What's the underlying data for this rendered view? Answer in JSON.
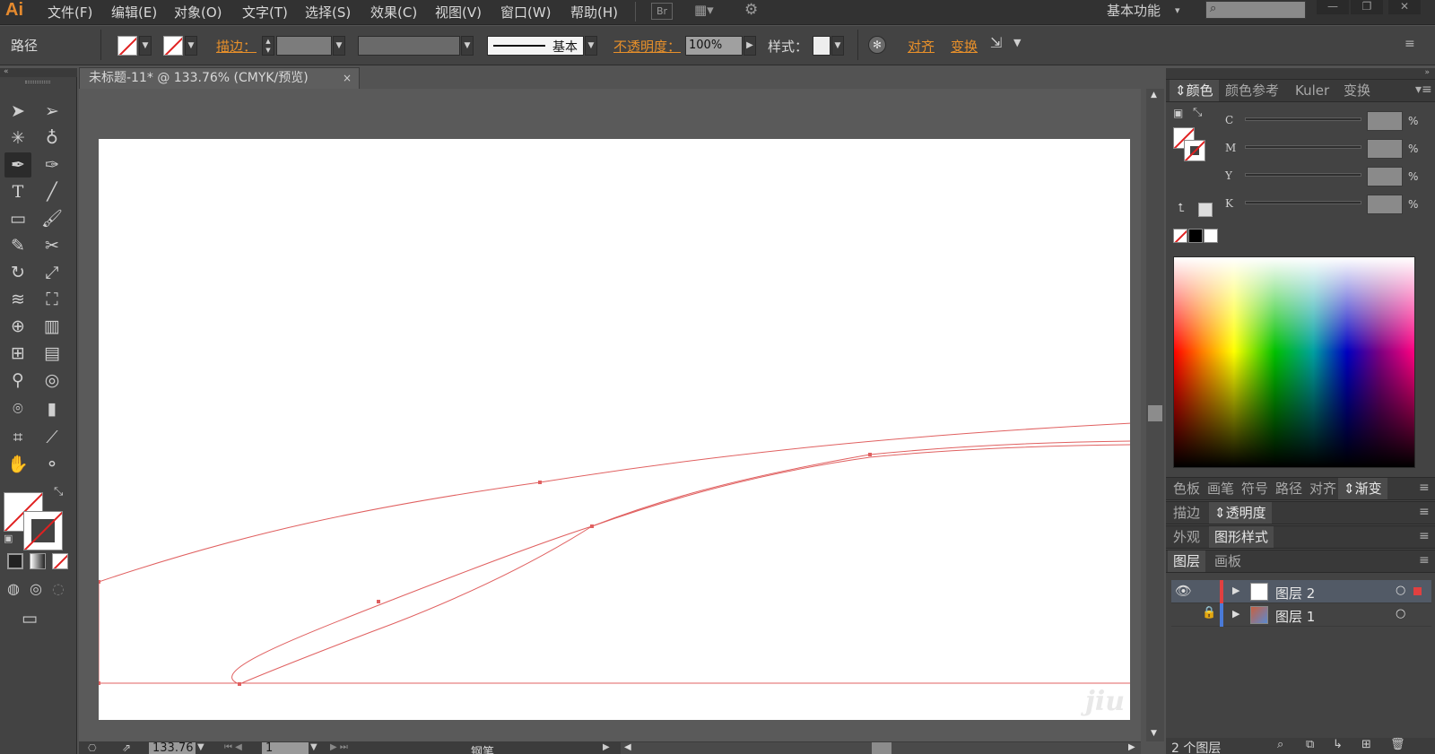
{
  "app": {
    "logo": "Ai"
  },
  "menu": [
    "文件(F)",
    "编辑(E)",
    "对象(O)",
    "文字(T)",
    "选择(S)",
    "效果(C)",
    "视图(V)",
    "窗口(W)",
    "帮助(H)"
  ],
  "menubar": {
    "bridge_label": "Br",
    "workspace": "基本功能"
  },
  "control": {
    "object_type": "路径",
    "stroke_label": "描边：",
    "brush_style": "基本",
    "opacity_label": "不透明度：",
    "opacity_value": "100%",
    "style_label": "样式：",
    "align_label": "对齐",
    "transform_label": "变换"
  },
  "document": {
    "tab_title": "未标题-11* @ 133.76% (CMYK/预览)",
    "close_glyph": "×"
  },
  "status": {
    "zoom": "133.76",
    "page": "1",
    "tool": "钢笔"
  },
  "color_panel": {
    "tabs": [
      "颜色",
      "颜色参考",
      "Kuler",
      "变换"
    ],
    "channels": [
      "C",
      "M",
      "Y",
      "K"
    ],
    "percent": "%"
  },
  "panel_groups": {
    "row1": [
      "色板",
      "画笔",
      "符号",
      "路径",
      "对齐",
      "渐变"
    ],
    "row2": [
      "描边",
      "透明度"
    ],
    "row3": [
      "外观",
      "图形样式"
    ],
    "row4": [
      "图层",
      "画板"
    ]
  },
  "layers": [
    {
      "name": "图层 2",
      "color": "#e04040"
    },
    {
      "name": "图层 1",
      "color": "#4a7ad8"
    }
  ],
  "layers_footer": "2 个图层",
  "colors": {
    "path_stroke": "#e06060",
    "accent_orange": "#e8902a"
  },
  "watermark": "jiu"
}
